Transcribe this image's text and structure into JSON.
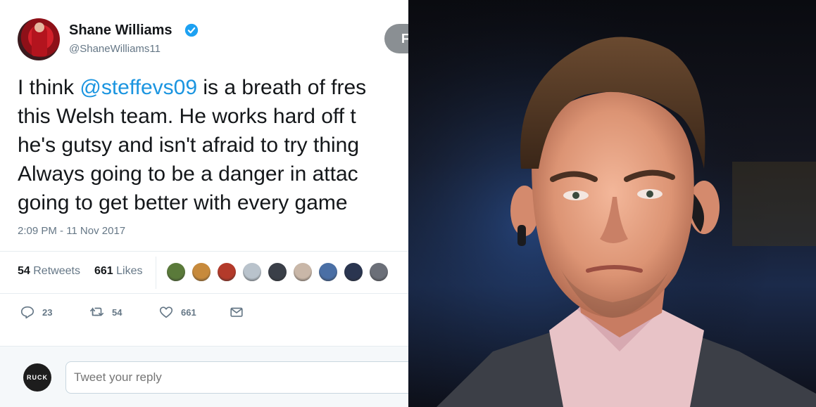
{
  "tweet": {
    "user_name": "Shane Williams",
    "user_handle": "@ShaneWilliams11",
    "follow_label": "F",
    "text": {
      "line1_prefix": "I think ",
      "line1_mention": "@steffevs09",
      "line1_suffix": " is a breath of fres",
      "line2": "this Welsh team. He works hard off t",
      "line3": "he's gutsy and isn't afraid to try thing",
      "line4": "Always going to be a danger in attac",
      "line5": "going to get better with every game"
    },
    "timestamp": "2:09 PM - 11 Nov 2017",
    "stats": {
      "retweets_count": "54",
      "retweets_label": "Retweets",
      "likes_count": "661",
      "likes_label": "Likes"
    },
    "likers": [
      "#5a7a3a",
      "#c78a3c",
      "#b33a2a",
      "#b9c3cc",
      "#3a3f48",
      "#c9b7a8",
      "#4a6fa5",
      "#2a3550",
      "#6b6f78"
    ],
    "actions": {
      "reply_count": "23",
      "retweet_count": "54",
      "like_count": "661"
    },
    "reply": {
      "avatar_text": "RUCK",
      "placeholder": "Tweet your reply"
    }
  },
  "colors": {
    "mention": "#1b95e0",
    "verified": "#1da1f2",
    "muted": "#657786"
  }
}
